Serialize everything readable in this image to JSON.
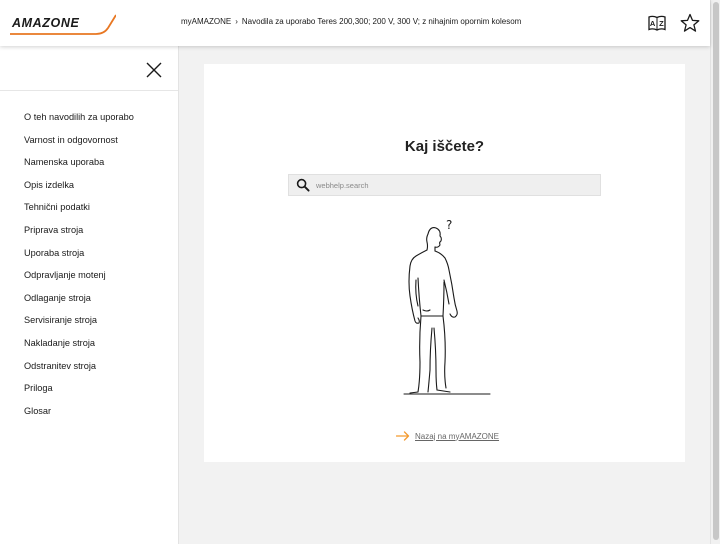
{
  "header": {
    "logo_text": "AMAZONE",
    "breadcrumb": {
      "root": "myAMAZONE",
      "separator": "›",
      "current": "Navodila za uporabo Teres 200,300; 200 V, 300 V; z nihajnim opornim kolesom"
    },
    "icons": [
      "dictionary-icon",
      "star-icon"
    ]
  },
  "sidebar": {
    "close_icon": "close-icon",
    "items": [
      {
        "label": "O teh navodilih za uporabo"
      },
      {
        "label": "Varnost in odgovornost"
      },
      {
        "label": "Namenska uporaba"
      },
      {
        "label": "Opis izdelka"
      },
      {
        "label": "Tehnični podatki"
      },
      {
        "label": "Priprava stroja"
      },
      {
        "label": "Uporaba stroja"
      },
      {
        "label": "Odpravljanje motenj"
      },
      {
        "label": "Odlaganje stroja"
      },
      {
        "label": "Servisiranje stroja"
      },
      {
        "label": "Nakladanje stroja"
      },
      {
        "label": "Odstranitev stroja"
      },
      {
        "label": "Priloga"
      },
      {
        "label": "Glosar"
      }
    ]
  },
  "main": {
    "title": "Kaj iščete?",
    "search": {
      "placeholder": "webhelp.search",
      "value": ""
    },
    "illustration_glyph": "?",
    "back_link": "Nazaj na myAMAZONE"
  },
  "colors": {
    "accent": "#f39a2f",
    "brand_orange": "#e87722",
    "text": "#1a1a1a",
    "background": "#f2f2f2"
  }
}
